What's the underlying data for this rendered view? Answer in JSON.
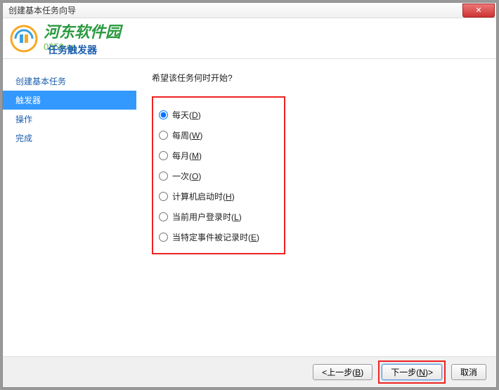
{
  "window": {
    "title": "创建基本任务向导",
    "close": "✕"
  },
  "header": {
    "brand": "河东软件园",
    "url": "0359.cn",
    "subtitle": "任务触发器"
  },
  "sidebar": {
    "items": [
      {
        "label": "创建基本任务",
        "selected": false
      },
      {
        "label": "触发器",
        "selected": true
      },
      {
        "label": "操作",
        "selected": false
      },
      {
        "label": "完成",
        "selected": false
      }
    ]
  },
  "content": {
    "question": "希望该任务何时开始?",
    "options": [
      {
        "label": "每天",
        "key": "D",
        "checked": true
      },
      {
        "label": "每周",
        "key": "W",
        "checked": false
      },
      {
        "label": "每月",
        "key": "M",
        "checked": false
      },
      {
        "label": "一次",
        "key": "O",
        "checked": false
      },
      {
        "label": "计算机启动时",
        "key": "H",
        "checked": false
      },
      {
        "label": "当前用户登录时",
        "key": "L",
        "checked": false
      },
      {
        "label": "当特定事件被记录时",
        "key": "E",
        "checked": false
      }
    ]
  },
  "footer": {
    "back": "上一步",
    "back_key": "B",
    "next": "下一步",
    "next_key": "N",
    "cancel": "取消"
  }
}
